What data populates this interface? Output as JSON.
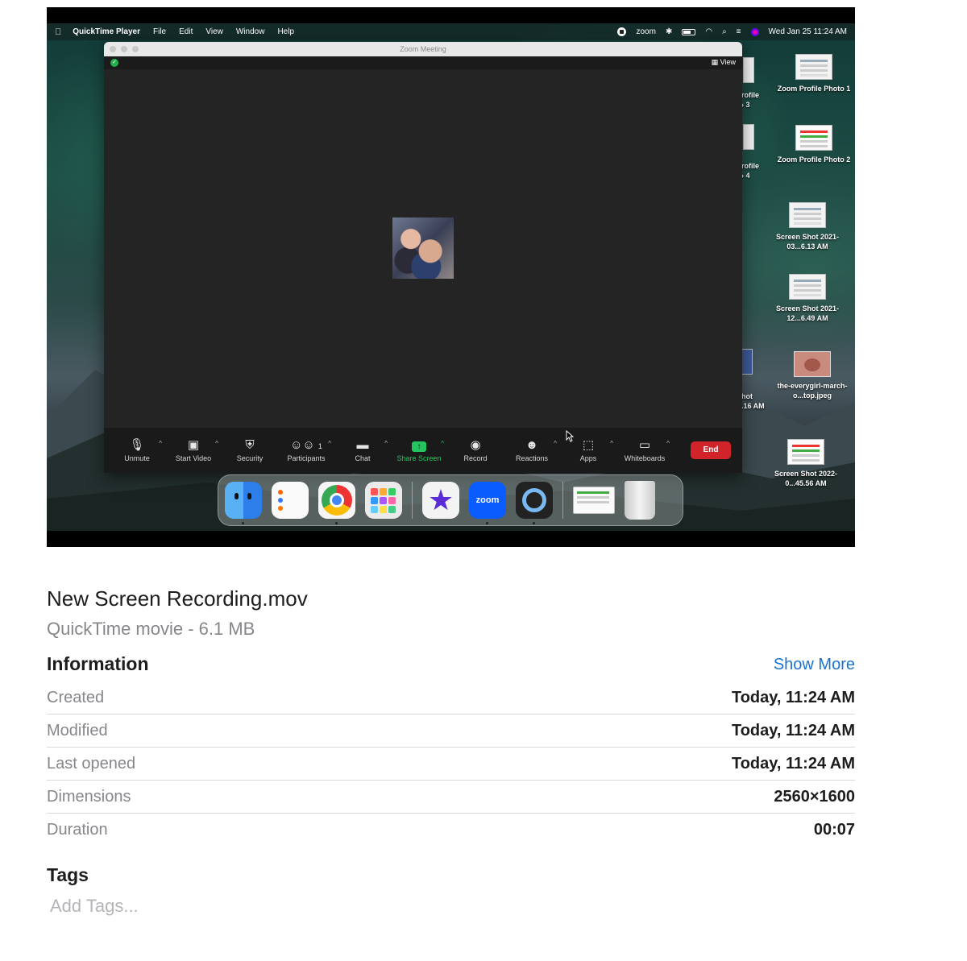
{
  "menubar": {
    "app_name": "QuickTime Player",
    "menus": [
      "File",
      "Edit",
      "View",
      "Window",
      "Help"
    ],
    "zoom_label": "zoom",
    "datetime": "Wed Jan 25  11:24 AM"
  },
  "zoom_window": {
    "title": "Zoom Meeting",
    "view_label": "View",
    "toolbar": [
      {
        "label": "Unmute",
        "icon": "microphone-muted-icon"
      },
      {
        "label": "Start Video",
        "icon": "video-off-icon"
      },
      {
        "label": "Security",
        "icon": "shield-icon"
      },
      {
        "label": "Participants",
        "icon": "participants-icon",
        "count": "1"
      },
      {
        "label": "Chat",
        "icon": "chat-icon"
      },
      {
        "label": "Share Screen",
        "icon": "share-screen-icon"
      },
      {
        "label": "Record",
        "icon": "record-icon"
      },
      {
        "label": "Reactions",
        "icon": "reactions-icon"
      },
      {
        "label": "Apps",
        "icon": "apps-icon"
      },
      {
        "label": "Whiteboards",
        "icon": "whiteboard-icon"
      }
    ],
    "end_label": "End",
    "accent_green": "#22c55e",
    "end_red": "#d1232a"
  },
  "desktop_icons": [
    {
      "label": "Zoom Profile Photo 1"
    },
    {
      "label": "Zoom Profile Photo 2"
    },
    {
      "label": "Screen Shot 2021-03...6.13 AM"
    },
    {
      "label": "Screen Shot 2021-12...6.49 AM"
    },
    {
      "label": "the-everygirl-march-o...top.jpeg"
    },
    {
      "label": "Screen Shot 2022-0...45.56 AM"
    }
  ],
  "desktop_partial": {
    "a1": "rofile",
    "a2": "› 3",
    "b1": "rofile",
    "b2": "› 4",
    "c1": "hot",
    "c2": ".16 AM"
  },
  "dock": {
    "zoom_label": "zoom"
  },
  "file": {
    "name": "New Screen Recording.mov",
    "kind_size": "QuickTime movie - 6.1 MB"
  },
  "information": {
    "heading": "Information",
    "show_more": "Show More",
    "rows": [
      {
        "label": "Created",
        "value": "Today, 11:24 AM"
      },
      {
        "label": "Modified",
        "value": "Today, 11:24 AM"
      },
      {
        "label": "Last opened",
        "value": "Today, 11:24 AM"
      },
      {
        "label": "Dimensions",
        "value": "2560×1600"
      },
      {
        "label": "Duration",
        "value": "00:07"
      }
    ]
  },
  "tags": {
    "heading": "Tags",
    "placeholder": "Add Tags..."
  }
}
